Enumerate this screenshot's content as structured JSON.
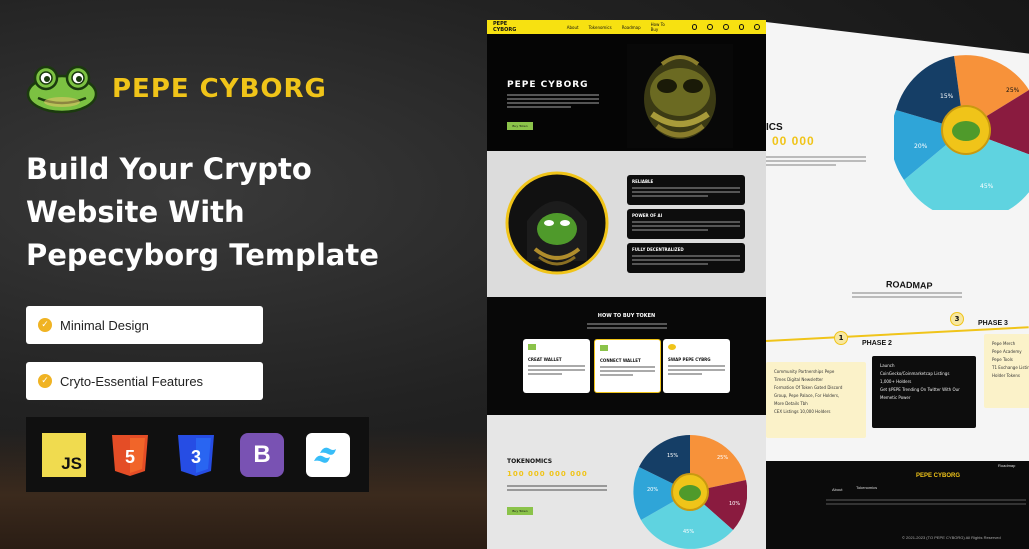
{
  "brand": {
    "name": "PEPE CYBORG"
  },
  "headline": {
    "line1": "Build Your Crypto",
    "line2": "Website With",
    "line3": "Pepecyborg Template"
  },
  "features": [
    {
      "label": "Minimal Design"
    },
    {
      "label": "Cryto-Essential Features"
    }
  ],
  "tech": [
    {
      "label": "JS",
      "icon": "javascript-icon",
      "color": "#f0db4f"
    },
    {
      "label": "5",
      "icon": "html5-icon",
      "color": "#e44d26"
    },
    {
      "label": "3",
      "icon": "css3-icon",
      "color": "#264de4"
    },
    {
      "label": "B",
      "icon": "bootstrap-icon",
      "color": "#7952b3"
    },
    {
      "label": "~",
      "icon": "tailwind-icon",
      "color": "#38bdf8"
    }
  ],
  "mock": {
    "nav": {
      "logo": "PEPE CYBORG",
      "links": [
        "About",
        "Tokenomics",
        "Roadmap",
        "How To Buy"
      ]
    },
    "hero": {
      "title": "PEPE CYBORG",
      "button": "Buy Token"
    },
    "cards": [
      {
        "title": "RELIABLE"
      },
      {
        "title": "POWER OF AI"
      },
      {
        "title": "FULLY DECENTRALIZED"
      }
    ],
    "how_to_buy": {
      "title": "HOW TO BUY TOKEN",
      "steps": [
        {
          "title": "CREAT WALLET"
        },
        {
          "title": "CONNECT WALLET"
        },
        {
          "title": "SWAP PEPE CYBRG"
        }
      ]
    },
    "tokenomics": {
      "title": "TOKENOMICS",
      "supply": "100 000 000 000",
      "button": "Buy Token"
    },
    "pie_labels": [
      "25%",
      "15%",
      "20%",
      "10%",
      "45%"
    ]
  },
  "right": {
    "partial_title": "ICS",
    "partial_supply": "00 000",
    "roadmap_title": "ROADMAP",
    "phases": [
      {
        "num": "1",
        "label": ""
      },
      {
        "num": "2",
        "label": "PHASE 2"
      },
      {
        "num": "3",
        "label": "PHASE 3"
      }
    ],
    "phase2_items": [
      "Launch",
      "CoinGecko/Coinmarketcap Listings",
      "1,000+ Holders",
      "Get $PEPE Trending On Twitter With Our Memetic Power"
    ],
    "phase3_items": [
      "Pepe Merch",
      "Pepe Academy",
      "Pepe Tools",
      "T1 Exchange Listings",
      "Holder Tokens"
    ],
    "phase1_items": [
      "Community Partnerships Pepe",
      "Times Digital Newsletter",
      "Formation Of Token Gated Discord",
      "Group, Pepe Palace, For Holders,",
      "More Details Tbh",
      "CEX Listings 10,000 Holders"
    ],
    "pie_labels": [
      "15%",
      "25%",
      "20%",
      "45%"
    ],
    "footer_logo": "PEPE CYBORG",
    "footer_links": [
      "About",
      "Tokenomics",
      "Roadmap"
    ],
    "copyright": "© 2021-2023 (TO PEPE CYBORG) All Rights Reserved"
  }
}
